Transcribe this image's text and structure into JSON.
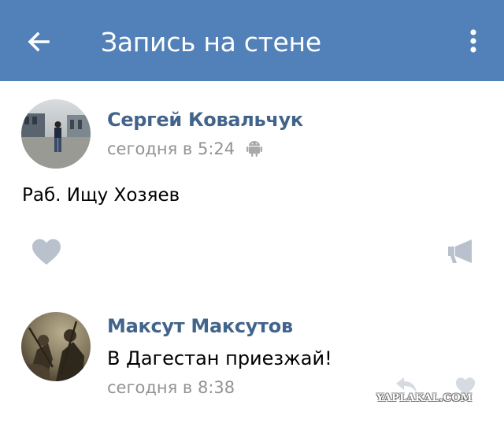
{
  "header": {
    "title": "Запись на стене",
    "back_icon": "back-arrow-icon",
    "menu_icon": "more-vertical-icon",
    "background": "#5181b8"
  },
  "post": {
    "author": "Сергей Ковальчук",
    "time": "сегодня в 5:24",
    "platform_icon": "android-icon",
    "text": "Раб. Ищу Хозяев",
    "like_icon": "heart-icon",
    "share_icon": "megaphone-icon"
  },
  "comment": {
    "author": "Максут Максутов",
    "text": "В Дагестан приезжай!",
    "time": "сегодня в 8:38",
    "reply_icon": "reply-icon",
    "like_icon": "heart-icon"
  },
  "watermark": "YAPLAKAL.COM",
  "colors": {
    "accent": "#5181b8",
    "name": "#42648b",
    "meta": "#939393",
    "icon": "#b8c1cc"
  }
}
